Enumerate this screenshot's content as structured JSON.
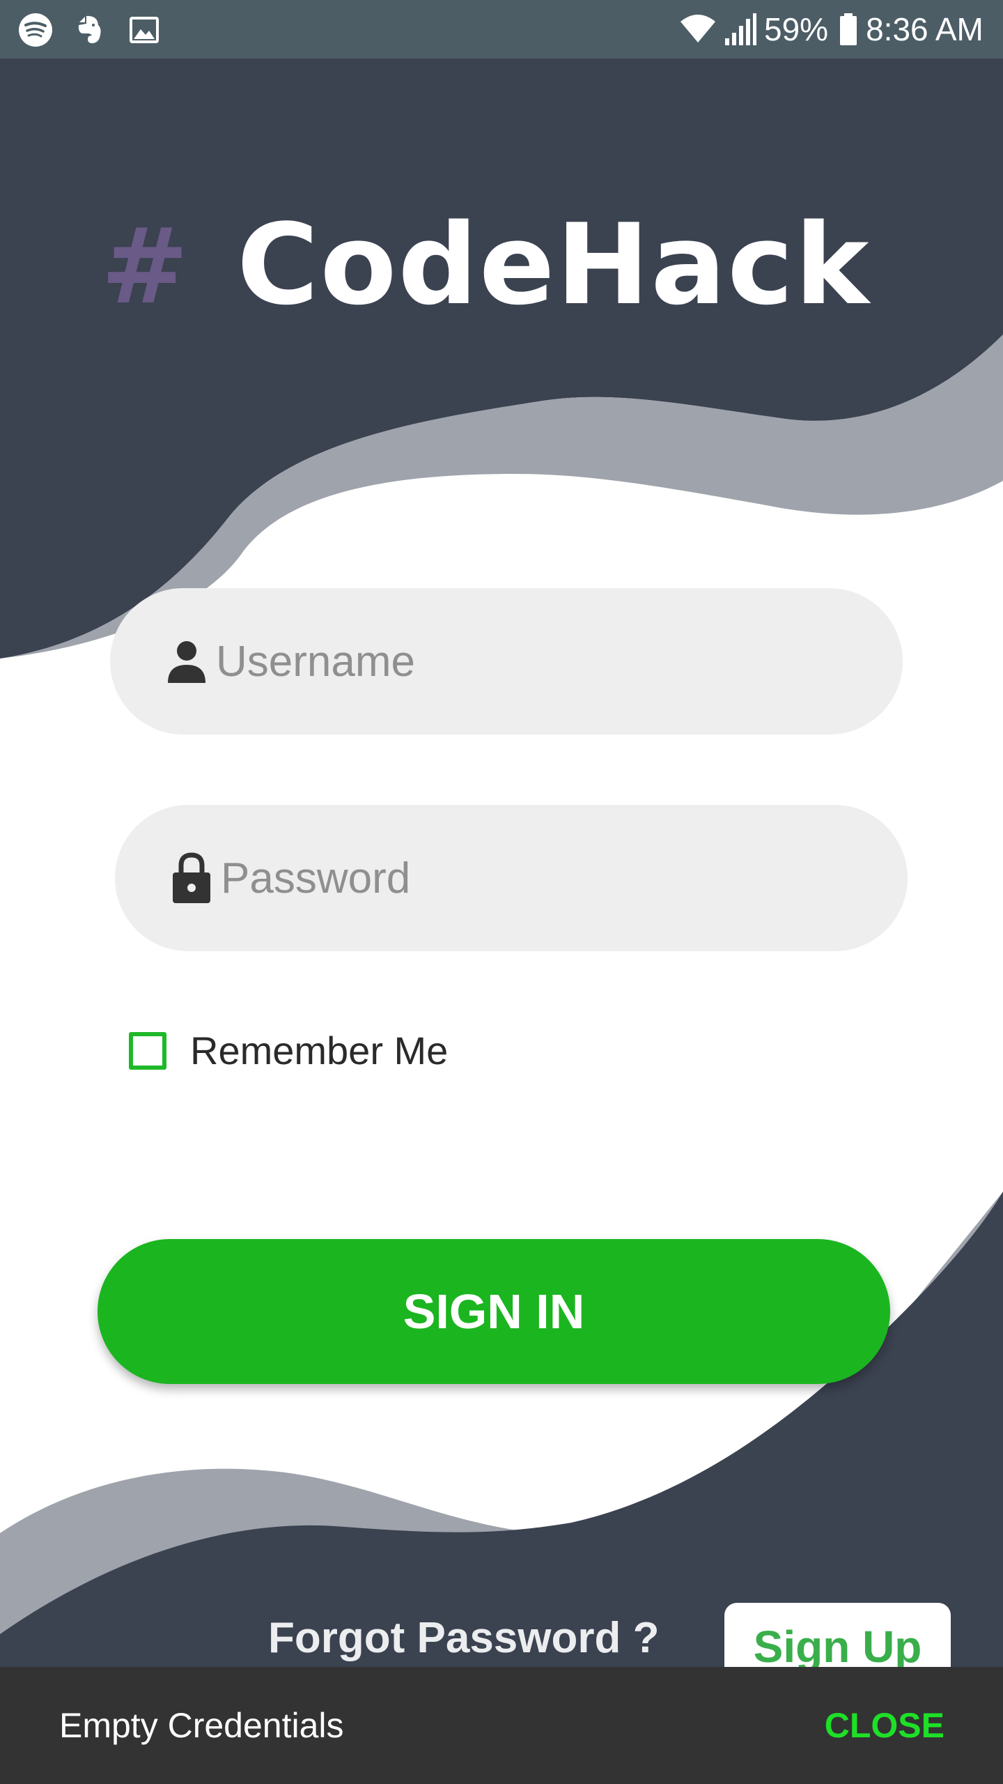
{
  "status_bar": {
    "left_icons": [
      "spotify-icon",
      "evernote-icon",
      "image-icon"
    ],
    "right_icons": [
      "wifi-icon",
      "signal-icon",
      "battery-icon"
    ],
    "battery_percent": "59%",
    "time": "8:36 AM"
  },
  "header": {
    "logo_symbol": "#",
    "app_name": "CodeHack"
  },
  "form": {
    "username": {
      "placeholder": "Username",
      "value": "",
      "icon": "person-icon"
    },
    "password": {
      "placeholder": "Password",
      "value": "",
      "icon": "lock-icon"
    },
    "remember_me": {
      "label": "Remember Me",
      "checked": false
    }
  },
  "actions": {
    "sign_in_label": "SIGN IN",
    "forgot_password_label": "Forgot Password ?",
    "sign_up_label": "Sign Up"
  },
  "snackbar": {
    "message": "Empty Credentials",
    "action_label": "CLOSE"
  },
  "colors": {
    "status_bar": "#4c5d66",
    "dark_navy": "#3b4250",
    "wave_gray": "#9fa3ab",
    "accent_green": "#1bb520",
    "logo_hash_purple": "#6a5a87",
    "snackbar_bg": "#333333",
    "snackbar_action": "#1ee027"
  }
}
